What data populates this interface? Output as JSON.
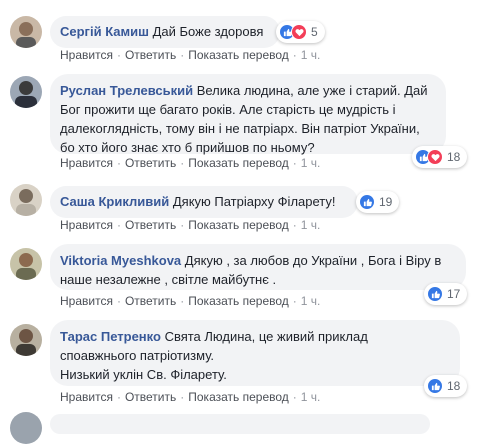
{
  "actions": {
    "like": "Нравится",
    "reply": "Ответить",
    "translate": "Показать перевод",
    "dot": "·"
  },
  "colors": {
    "author": "#385898",
    "bubble": "#f2f3f5",
    "like": "#3578e5",
    "love": "#f33e58"
  },
  "comments": [
    {
      "author": "Сергій Камиш",
      "text": "Дай Боже здоровя",
      "time": "1 ч.",
      "reaction_count": "5",
      "reaction_icons": [
        "like-icon",
        "love-icon"
      ]
    },
    {
      "author": "Руслан Трелевський",
      "text": "Велика людина, але уже і старий. Дай Бог прожити ще багато років. Але старість це мудрість і далекоглядність, тому він і не патріарх. Він патріот України, бо хто його знає хто б прийшов по ньому?",
      "time": "1 ч.",
      "reaction_count": "18",
      "reaction_icons": [
        "like-icon",
        "love-icon"
      ]
    },
    {
      "author": "Саша Крикливий",
      "text": "Дякую Патріарху Філарету!",
      "time": "1 ч.",
      "reaction_count": "19",
      "reaction_icons": [
        "like-icon"
      ]
    },
    {
      "author": "Viktoria Myeshkova",
      "text": "Дякую , за любов до України , Бога і Віру в наше незалежне , світле майбутнє .",
      "time": "1 ч.",
      "reaction_count": "17",
      "reaction_icons": [
        "like-icon"
      ]
    },
    {
      "author": "Тарас Петренко",
      "text_lines": [
        "Свята Людина, це живий приклад",
        "споавжнього патріотизму.",
        "Низький уклін Св. Філарету."
      ],
      "time": "1 ч.",
      "reaction_count": "18",
      "reaction_icons": [
        "like-icon"
      ]
    }
  ]
}
